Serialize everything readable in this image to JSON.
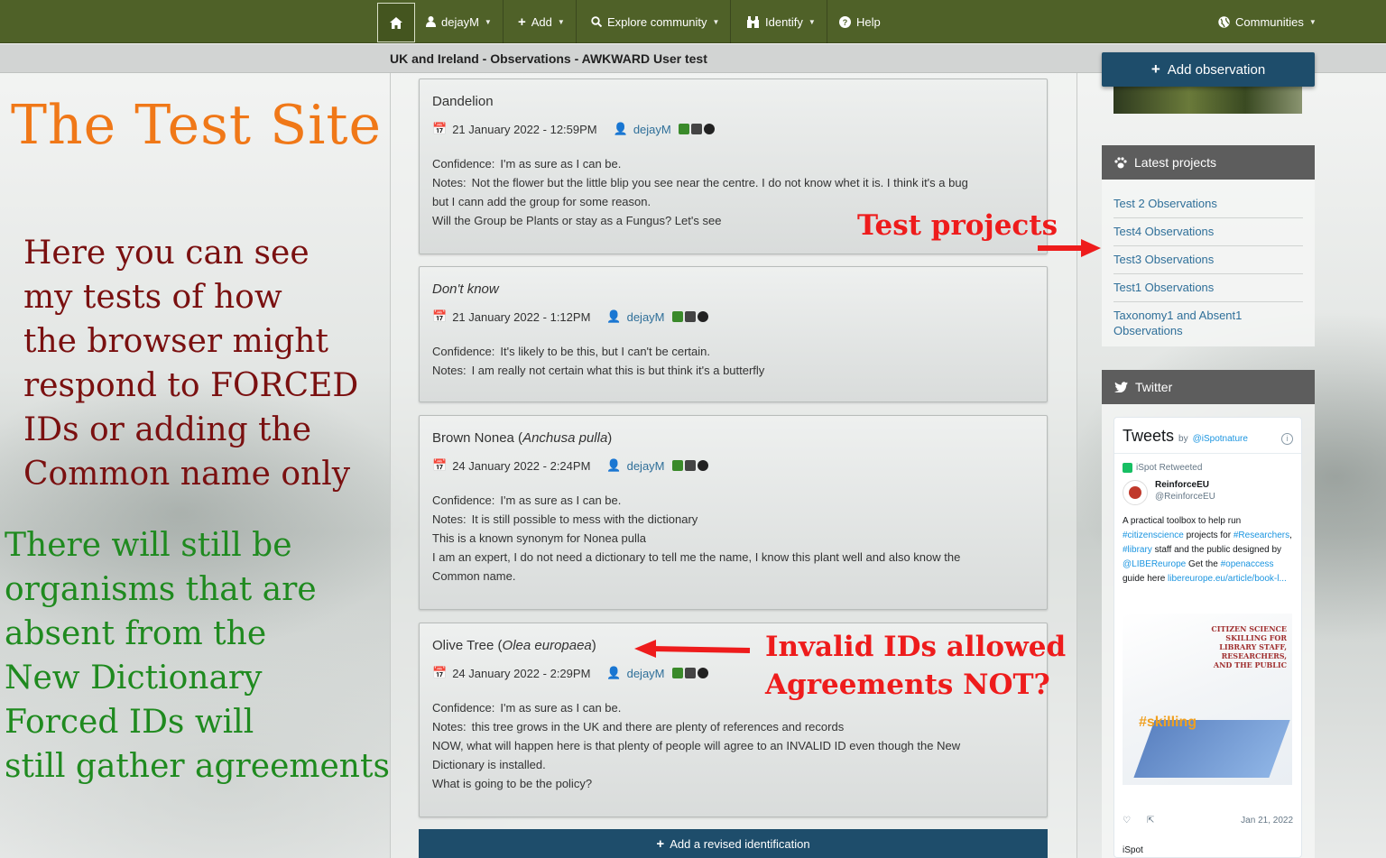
{
  "navbar": {
    "items": [
      {
        "label": "dejayM",
        "icon": "user-icon"
      },
      {
        "label": "Add",
        "icon": "plus-icon"
      },
      {
        "label": "Explore community",
        "icon": "search-icon"
      },
      {
        "label": "Identify",
        "icon": "binoculars-icon"
      },
      {
        "label": "Help",
        "icon": "question-circle-icon"
      },
      {
        "label": "Communities",
        "icon": "globe-icon"
      }
    ]
  },
  "subheader": {
    "title": "UK and Ireland - Observations - AWKWARD User test"
  },
  "left_annotation": {
    "title": "The Test Site",
    "red_lines": [
      "Here you can see",
      "my tests of how",
      "the browser might",
      "respond to FORCED",
      "IDs or adding the",
      "Common name only"
    ],
    "green_lines": [
      "There will still be",
      "organisms that are",
      "absent from the",
      "New Dictionary",
      "Forced IDs will",
      "still gather agreements"
    ]
  },
  "observations": [
    {
      "title": "Dandelion",
      "title_italic": "",
      "title_suffix": "",
      "date": "21 January 2022 - 12:59PM",
      "user": "dejayM",
      "confidence_label": "Confidence:",
      "confidence": "I'm as sure as I can be.",
      "notes_label": "Notes:",
      "notes": [
        "Not the flower but the little blip you see near the centre. I do not know whet it is. I think it's a bug",
        "but I cann add the group for some reason.",
        "Will the Group be Plants or stay as a Fungus? Let's see"
      ]
    },
    {
      "title": "",
      "title_italic": "Don't know",
      "title_suffix": "",
      "date": "21 January 2022 - 1:12PM",
      "user": "dejayM",
      "confidence_label": "Confidence:",
      "confidence": "It's likely to be this, but I can't be certain.",
      "notes_label": "Notes:",
      "notes": [
        "I am really not certain what this is but think it's a butterfly"
      ]
    },
    {
      "title": "Brown Nonea (",
      "title_italic": "Anchusa pulla",
      "title_suffix": ")",
      "date": "24 January 2022 - 2:24PM",
      "user": "dejayM",
      "confidence_label": "Confidence:",
      "confidence": "I'm as sure as I can be.",
      "notes_label": "Notes:",
      "notes": [
        "It is still possible to mess with the dictionary",
        "This is a known synonym for Nonea pulla",
        "I am an expert, I do not need a dictionary to tell me the name, I know this plant well and also know the",
        "Common name."
      ]
    },
    {
      "title": "Olive Tree (",
      "title_italic": "Olea europaea",
      "title_suffix": ")",
      "date": "24 January 2022 - 2:29PM",
      "user": "dejayM",
      "confidence_label": "Confidence:",
      "confidence": "I'm as sure as I can be.",
      "notes_label": "Notes:",
      "notes": [
        "this tree grows in the UK and there are plenty of references and records",
        "NOW, what will happen here is that plenty of people will agree to an INVALID ID even though the New",
        "Dictionary is installed.",
        "What is going to be the policy?"
      ]
    }
  ],
  "revise_button": {
    "label": "Add a revised identification"
  },
  "sidebar": {
    "add_observation": "Add observation",
    "latest_projects": {
      "heading": "Latest projects",
      "items": [
        "Test 2 Observations",
        "Test4 Observations",
        "Test3 Observations",
        "Test1 Observations",
        "Taxonomy1 and Absent1 Observations"
      ]
    },
    "twitter": {
      "heading": "Twitter",
      "tweets_title": "Tweets",
      "by": "by",
      "handle": "@iSpotnature",
      "retweeted": "iSpot Retweeted",
      "author_name": "ReinforceEU",
      "author_handle": "@ReinforceEU",
      "text_1": "A practical toolbox to help run",
      "link_1": "#citizenscience",
      "text_2": "projects for",
      "link_2": "#Researchers",
      "link_3": "#library",
      "text_3": "staff and the public designed by",
      "link_4": "@LIBEReurope",
      "text_4": "Get the",
      "link_5": "#openaccess",
      "text_5": "guide here",
      "link_6": "libereurope.eu/article/book-l...",
      "image_title": "CITIZEN SCIENCE SKILLING FOR LIBRARY STAFF, RESEARCHERS, AND THE PUBLIC",
      "image_tag": "#skilling",
      "date": "Jan 21, 2022",
      "next_author": "iSpot"
    }
  },
  "annotations": {
    "test_projects": "Test projects",
    "invalid_line1": "Invalid IDs allowed",
    "invalid_line2": "Agreements NOT?"
  },
  "colors": {
    "navbar": "#4f6128",
    "button": "#1e4d6b",
    "link": "#2f6f99",
    "orange": "#f07818",
    "red_annotation": "#ee1c1c"
  }
}
